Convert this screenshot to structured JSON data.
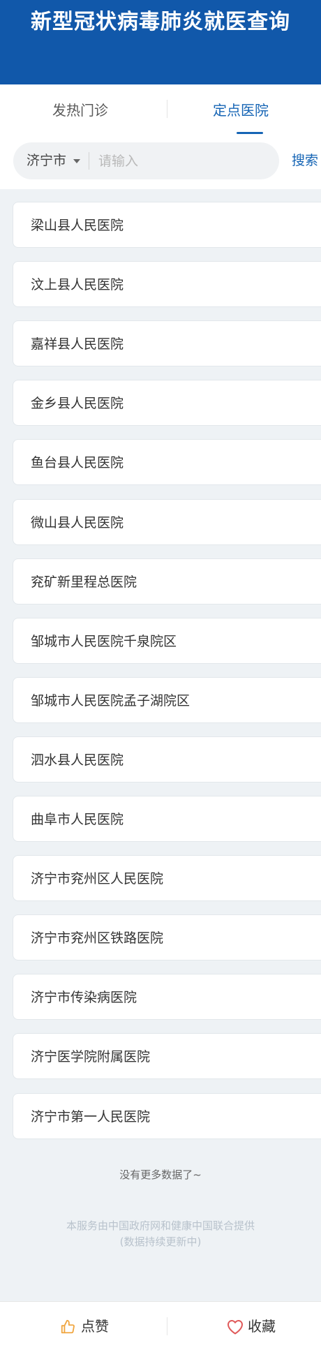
{
  "header": {
    "title": "新型冠状病毒肺炎就医查询"
  },
  "tabs": [
    {
      "label": "发热门诊",
      "active": false
    },
    {
      "label": "定点医院",
      "active": true
    }
  ],
  "search": {
    "city": "济宁市",
    "placeholder": "请输入",
    "value": "",
    "button_label": "搜索"
  },
  "hospitals": [
    {
      "name": "梁山县人民医院"
    },
    {
      "name": "汶上县人民医院"
    },
    {
      "name": "嘉祥县人民医院"
    },
    {
      "name": "金乡县人民医院"
    },
    {
      "name": "鱼台县人民医院"
    },
    {
      "name": "微山县人民医院"
    },
    {
      "name": "兖矿新里程总医院"
    },
    {
      "name": "邹城市人民医院千泉院区"
    },
    {
      "name": "邹城市人民医院孟子湖院区"
    },
    {
      "name": "泗水县人民医院"
    },
    {
      "name": "曲阜市人民医院"
    },
    {
      "name": "济宁市兖州区人民医院"
    },
    {
      "name": "济宁市兖州区铁路医院"
    },
    {
      "name": "济宁市传染病医院"
    },
    {
      "name": "济宁医学院附属医院"
    },
    {
      "name": "济宁市第一人民医院"
    }
  ],
  "list_end_text": "没有更多数据了~",
  "footer": {
    "line1": "本服务由中国政府网和健康中国联合提供",
    "line2": "(数据持续更新中)"
  },
  "bottom_bar": {
    "like": {
      "label": "点赞",
      "icon": "thumbs-up-icon"
    },
    "favorite": {
      "label": "收藏",
      "icon": "heart-icon"
    }
  },
  "colors": {
    "header_bg": "#1158aa",
    "accent": "#1665b5",
    "like_icon": "#f0a640",
    "favorite_icon": "#e05a5a",
    "page_bg": "#eef2f5"
  }
}
